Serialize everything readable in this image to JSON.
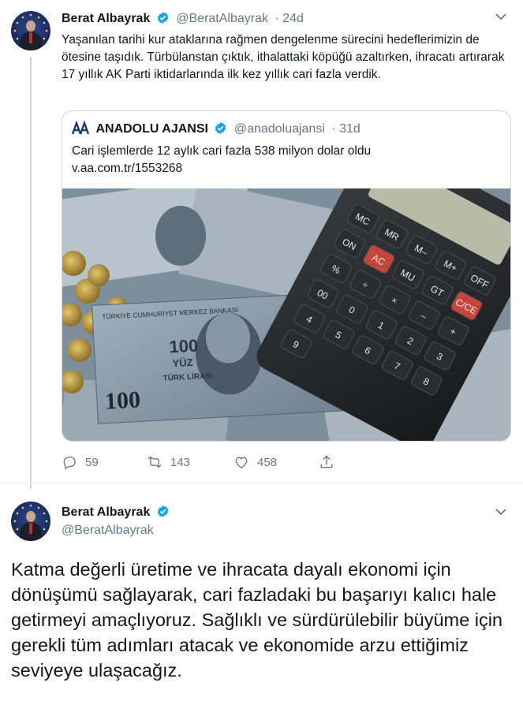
{
  "tweet1": {
    "author_name": "Berat Albayrak",
    "handle": "@BeratAlbayrak",
    "time": "· 24d",
    "text": "Yaşanılan tarihi kur ataklarına rağmen dengelenme sürecini hedeflerimizin de ötesine taşıdık. Türbülanstan çıktık, ithalattaki köpüğü azaltırken, ihracatı artırarak 17 yıllık AK Parti iktidarlarında ilk kez yıllık cari fazla verdik.",
    "quote": {
      "author_name": "ANADOLU AJANSI",
      "handle": "@anadoluajansi",
      "time": "· 31d",
      "text": "Cari işlemlerde 12 aylık cari fazla 538 milyon dolar oldu",
      "link": "v.aa.com.tr/1553268",
      "image_text": {
        "banknote_header": "TÜRKİYE CUMHURİYET MERKEZ BANKASI",
        "banknote_value": "100",
        "banknote_yuz": "YÜZ",
        "banknote_lira": "TÜRK LİRASI",
        "banknote_corner": "100",
        "calc_keys": [
          "MC",
          "MR",
          "M–",
          "M+",
          "OFF",
          "ON",
          "AC",
          "MU",
          "GT",
          "C/CE",
          "%",
          "÷",
          "×",
          "–",
          "+",
          "00",
          "0",
          "1",
          "2",
          "3",
          "4",
          "5",
          "6",
          "7",
          "8",
          "9"
        ]
      }
    },
    "actions": {
      "replies": "59",
      "retweets": "143",
      "likes": "458"
    }
  },
  "tweet2": {
    "author_name": "Berat Albayrak",
    "handle": "@BeratAlbayrak",
    "text": "Katma değerli üretime ve ihracata dayalı ekonomi için dönüşümü sağlayarak, cari fazladaki bu başarıyı kalıcı hale getirmeyi amaçlıyoruz. Sağlıklı ve sürdürülebilir büyüme için gerekli tüm adımları atacak ve ekonomide arzu ettiğimiz seviyeye ulaşacağız."
  },
  "colors": {
    "verified": "#1da1f2",
    "secondary_text": "#657786",
    "thread_line": "#ccd6dd"
  },
  "icons": [
    "verified-badge-icon",
    "chevron-down-icon",
    "reply-icon",
    "retweet-icon",
    "like-icon",
    "share-icon",
    "anadolu-logo-icon"
  ]
}
